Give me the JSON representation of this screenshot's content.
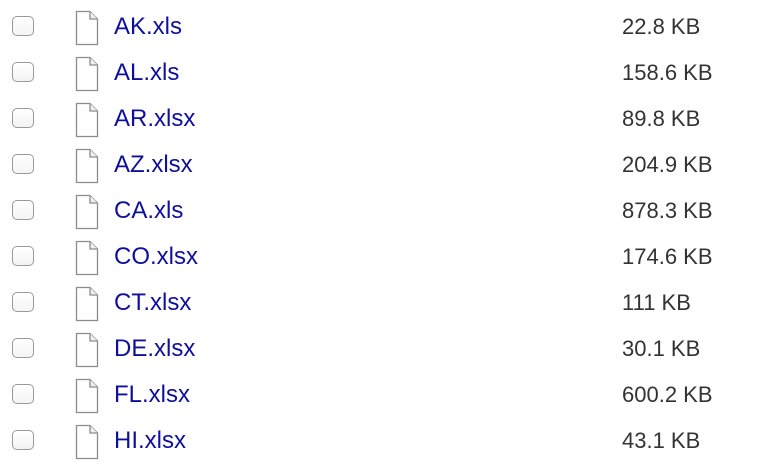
{
  "files": [
    {
      "name": "AK.xls",
      "size": "22.8 KB",
      "icon": "file-icon"
    },
    {
      "name": "AL.xls",
      "size": "158.6 KB",
      "icon": "file-icon"
    },
    {
      "name": "AR.xlsx",
      "size": "89.8 KB",
      "icon": "file-icon"
    },
    {
      "name": "AZ.xlsx",
      "size": "204.9 KB",
      "icon": "file-icon"
    },
    {
      "name": "CA.xls",
      "size": "878.3 KB",
      "icon": "file-icon"
    },
    {
      "name": "CO.xlsx",
      "size": "174.6 KB",
      "icon": "file-icon"
    },
    {
      "name": "CT.xlsx",
      "size": "111 KB",
      "icon": "file-icon"
    },
    {
      "name": "DE.xlsx",
      "size": "30.1 KB",
      "icon": "file-icon"
    },
    {
      "name": "FL.xlsx",
      "size": "600.2 KB",
      "icon": "file-icon"
    },
    {
      "name": "HI.xlsx",
      "size": "43.1 KB",
      "icon": "file-icon"
    }
  ],
  "colors": {
    "link": "#0f0f9e",
    "size_text": "#333333",
    "checkbox_border": "#9a9a9a"
  }
}
